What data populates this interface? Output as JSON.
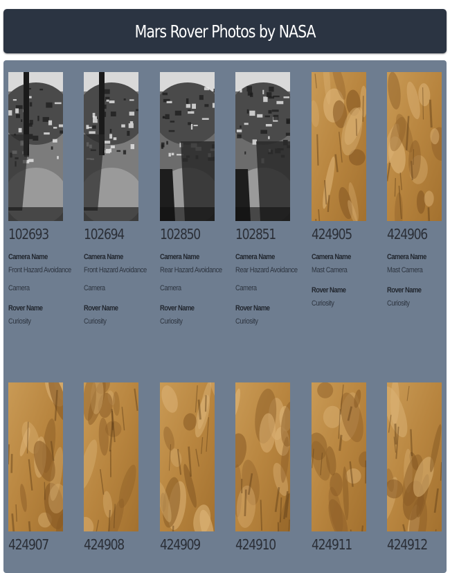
{
  "header": {
    "title": "Mars Rover Photos by NASA"
  },
  "labels": {
    "camera": "Camera Name",
    "rover": "Rover Name"
  },
  "photos": [
    {
      "id": "102693",
      "camera": [
        "Front Hazard Avoidance",
        "Camera"
      ],
      "rover": "Curiosity",
      "style": "hazf"
    },
    {
      "id": "102694",
      "camera": [
        "Front Hazard Avoidance",
        "Camera"
      ],
      "rover": "Curiosity",
      "style": "hazf"
    },
    {
      "id": "102850",
      "camera": [
        "Rear Hazard Avoidance",
        "Camera"
      ],
      "rover": "Curiosity",
      "style": "hazr"
    },
    {
      "id": "102851",
      "camera": [
        "Rear Hazard Avoidance",
        "Camera"
      ],
      "rover": "Curiosity",
      "style": "hazr"
    },
    {
      "id": "424905",
      "camera": [
        "Mast Camera"
      ],
      "rover": "Curiosity",
      "style": "mast"
    },
    {
      "id": "424906",
      "camera": [
        "Mast Camera"
      ],
      "rover": "Curiosity",
      "style": "mast"
    },
    {
      "id": "424907",
      "style": "mast"
    },
    {
      "id": "424908",
      "style": "mast"
    },
    {
      "id": "424909",
      "style": "mast"
    },
    {
      "id": "424910",
      "style": "mast"
    },
    {
      "id": "424911",
      "style": "mast"
    },
    {
      "id": "424912",
      "style": "mast"
    }
  ]
}
